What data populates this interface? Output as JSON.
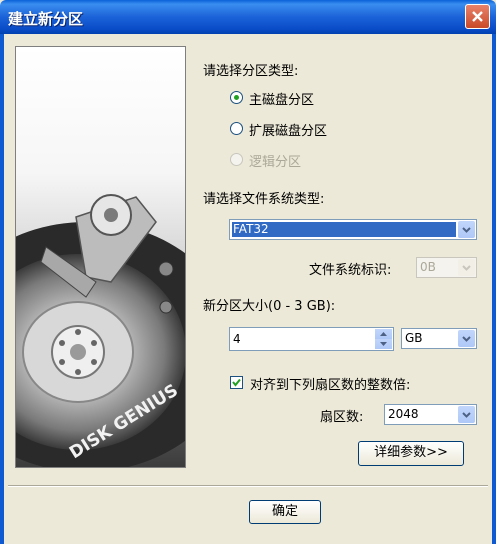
{
  "window": {
    "title": "建立新分区"
  },
  "partition_type": {
    "label": "请选择分区类型:",
    "options": [
      {
        "label": "主磁盘分区",
        "selected": true,
        "enabled": true
      },
      {
        "label": "扩展磁盘分区",
        "selected": false,
        "enabled": true
      },
      {
        "label": "逻辑分区",
        "selected": false,
        "enabled": false
      }
    ]
  },
  "filesystem": {
    "label": "请选择文件系统类型:",
    "value": "FAT32",
    "id_label": "文件系统标识:",
    "id_value": "0B"
  },
  "size": {
    "label": "新分区大小(0 - 3 GB):",
    "value": "4",
    "unit": "GB"
  },
  "align": {
    "checkbox_label": "对齐到下列扇区数的整数倍:",
    "checked": true,
    "sectors_label": "扇区数:",
    "sectors_value": "2048"
  },
  "buttons": {
    "details": "详细参数>>",
    "ok": "确定"
  },
  "image": {
    "brand_text": "DISK GENIUS"
  },
  "colors": {
    "title_bar": "#0a4cc8",
    "selection": "#316ac5",
    "dialog_bg": "#ece9d8"
  }
}
